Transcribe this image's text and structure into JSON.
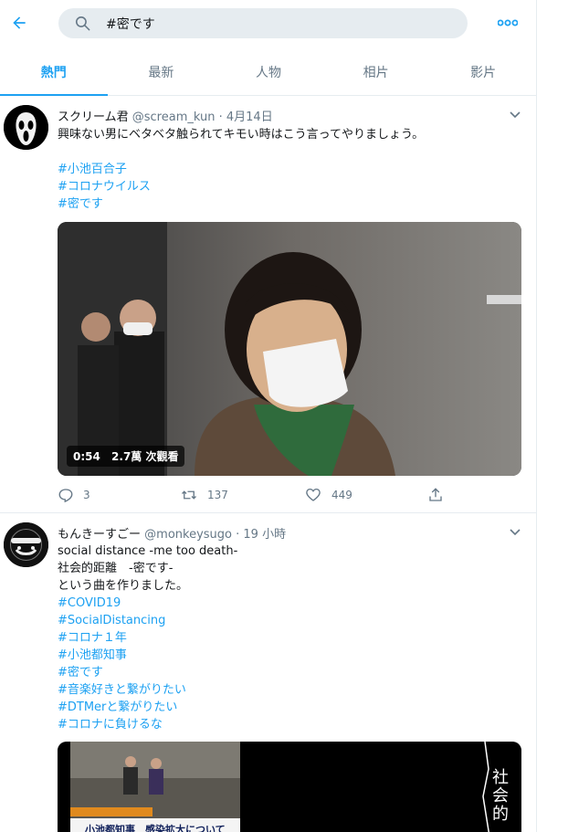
{
  "search": {
    "query": "#密です"
  },
  "tabs": [
    {
      "label": "熱門",
      "active": true
    },
    {
      "label": "最新"
    },
    {
      "label": "人物"
    },
    {
      "label": "相片"
    },
    {
      "label": "影片"
    }
  ],
  "tweets": [
    {
      "name": "スクリーム君",
      "handle": "@scream_kun",
      "time": "· 4月14日",
      "text": "興味ない男にベタベタ触られてキモい時はこう言ってやりましょう。",
      "hashtags": [
        "#小池百合子",
        "#コロナウイルス",
        "#密です"
      ],
      "video": {
        "duration": "0:54",
        "views": "2.7萬 次觀看"
      },
      "replies": "3",
      "retweets": "137",
      "likes": "449"
    },
    {
      "name": "もんきーすごー",
      "handle": "@monkeysugo",
      "time": "· 19 小時",
      "lines": [
        "social distance -me too death-",
        "社会的距離　-密です-",
        "という曲を作りました。"
      ],
      "hashtags": [
        "#COVID19",
        "#SocialDistancing",
        "#コロナ１年",
        "#小池都知事",
        "#密です",
        "#音楽好きと繋がりたい",
        "#DTMerと繋がりたい",
        "#コロナに負けるな"
      ],
      "media_caption": "小池都知事　感染拡大について",
      "media_side_text": "社会的"
    }
  ],
  "colors": {
    "accent": "#1da1f2",
    "muted": "#657786",
    "border": "#e6ecf0"
  }
}
